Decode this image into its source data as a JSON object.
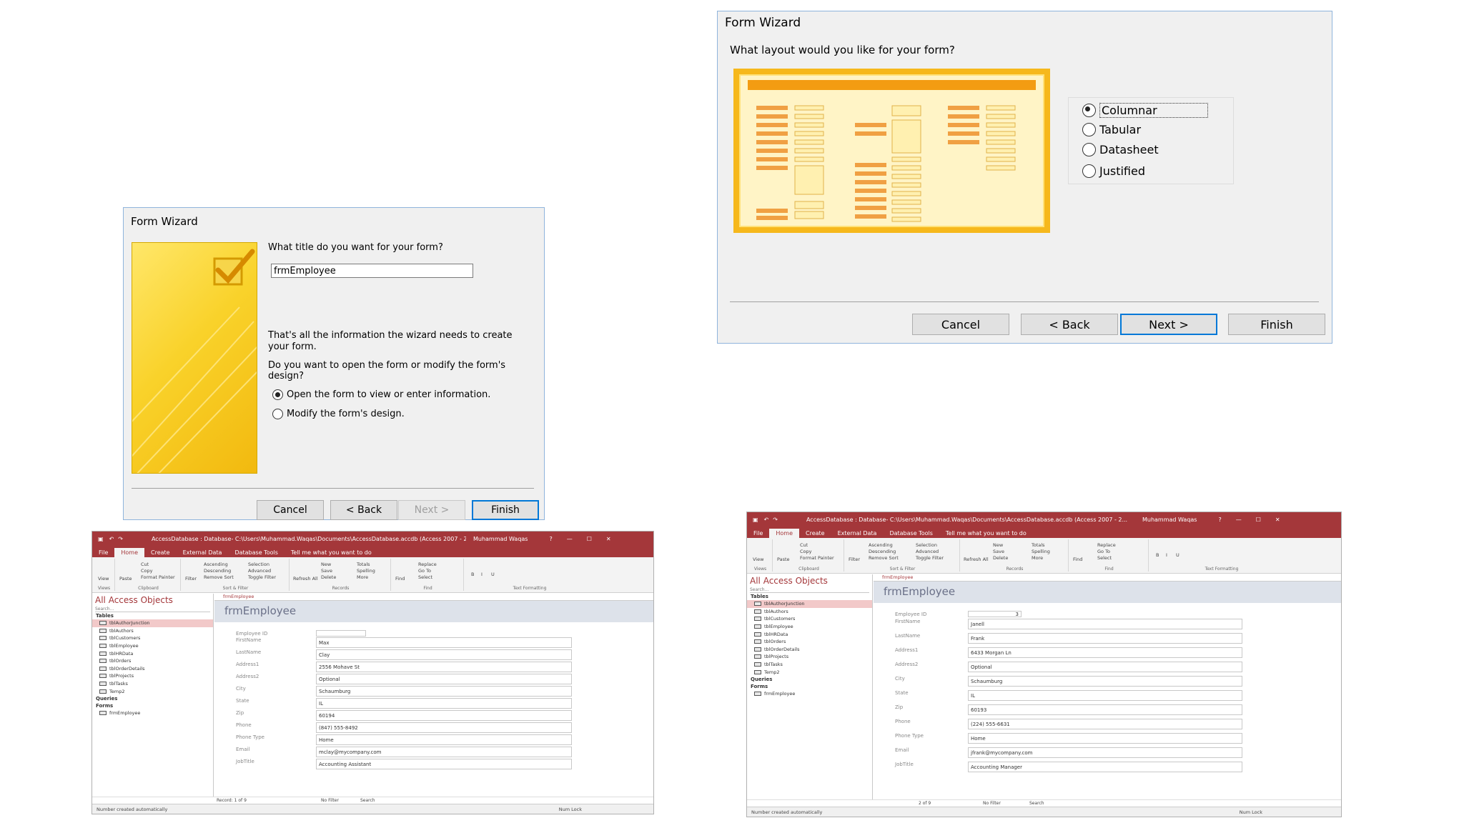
{
  "dialog_title": {
    "title": "Form Wizard",
    "question": "What title do you want for your form?",
    "input_value": "frmEmployee",
    "info": "That's all the information the wizard needs to create your form.",
    "question2": "Do you want to open the form or modify the form's design?",
    "options": [
      {
        "label": "Open the form to view or enter information.",
        "selected": true
      },
      {
        "label": "Modify the form's design.",
        "selected": false
      }
    ],
    "buttons": {
      "cancel": "Cancel",
      "back": "< Back",
      "next": "Next >",
      "finish": "Finish"
    }
  },
  "dialog_layout": {
    "title": "Form Wizard",
    "question": "What layout would you like for your form?",
    "options": [
      {
        "label": "Columnar",
        "selected": true
      },
      {
        "label": "Tabular",
        "selected": false
      },
      {
        "label": "Datasheet",
        "selected": false
      },
      {
        "label": "Justified",
        "selected": false
      }
    ],
    "buttons": {
      "cancel": "Cancel",
      "back": "< Back",
      "next": "Next >",
      "finish": "Finish"
    }
  },
  "access_common": {
    "title_bar": "AccessDatabase : Database- C:\\Users\\Muhammad.Waqas\\Documents\\AccessDatabase.accdb (Access 2007 - 2...",
    "user": "Muhammad Waqas",
    "tabs": [
      "File",
      "Home",
      "Create",
      "External Data",
      "Database Tools"
    ],
    "tell_me": "Tell me what you want to do",
    "ribbon_groups": [
      {
        "label": "Views",
        "items": [
          "View"
        ]
      },
      {
        "label": "Clipboard",
        "items": [
          "Paste",
          "Cut",
          "Copy",
          "Format Painter"
        ]
      },
      {
        "label": "Sort & Filter",
        "items": [
          "Filter",
          "Ascending",
          "Descending",
          "Remove Sort",
          "Selection",
          "Advanced",
          "Toggle Filter"
        ]
      },
      {
        "label": "Records",
        "items": [
          "Refresh All",
          "New",
          "Save",
          "Delete",
          "Totals",
          "Spelling",
          "More"
        ]
      },
      {
        "label": "Find",
        "items": [
          "Find",
          "Replace",
          "Go To",
          "Select"
        ]
      },
      {
        "label": "Text Formatting",
        "items": [
          "B",
          "I",
          "U"
        ]
      }
    ],
    "nav_title": "All Access Objects",
    "search": "Search...",
    "section_tables": "Tables",
    "tables": [
      "tblAuthorJunction",
      "tblAuthors",
      "tblCustomers",
      "tblEmployee",
      "tblHRData",
      "tblOrders",
      "tblOrderDetails",
      "tblProjects",
      "tblTasks",
      "Temp2"
    ],
    "section_queries": "Queries",
    "section_forms": "Forms",
    "forms": [
      "frmEmployee"
    ],
    "form_tab": "frmEmployee",
    "form_header": "frmEmployee",
    "labels": [
      "Employee ID",
      "FirstName",
      "LastName",
      "Address1",
      "Address2",
      "City",
      "State",
      "Zip",
      "Phone",
      "Phone Type",
      "Email",
      "JobTitle"
    ],
    "status": "Number created automatically",
    "num_lock": "Num Lock",
    "no_filter": "No Filter",
    "search_box": "Search"
  },
  "access_left": {
    "record": "Record: 1 of 9",
    "values": [
      "",
      "Max",
      "Clay",
      "2556 Mohave St",
      "Optional",
      "Schaumburg",
      "IL",
      "60194",
      "(847) 555-8492",
      "Home",
      "mclay@mycompany.com",
      "Accounting Assistant"
    ]
  },
  "access_right": {
    "record": "2 of 9",
    "values": [
      "3",
      "Janell",
      "Frank",
      "6433 Morgan Ln",
      "Optional",
      "Schaumburg",
      "IL",
      "60193",
      "(224) 555-6631",
      "Home",
      "jfrank@mycompany.com",
      "Accounting Manager"
    ]
  },
  "colors": {
    "access_red": "#a4373a",
    "wizard_yellow": "#f5c518",
    "focus_blue": "#0078d7"
  }
}
